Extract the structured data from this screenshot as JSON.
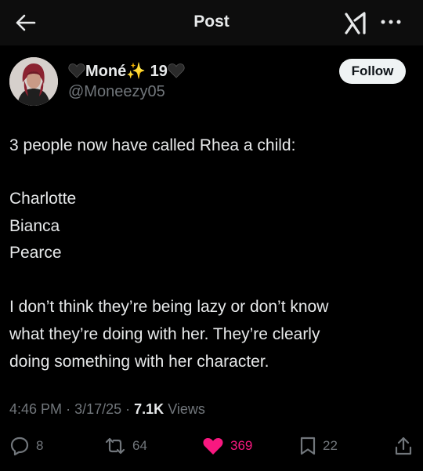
{
  "header": {
    "title": "Post",
    "back_icon": "arrow-left-icon",
    "grok_icon": "grok-icon",
    "more_icon": "more-dots-icon"
  },
  "author": {
    "display_name": "Moné✨ 19",
    "name_decorations": [
      "black-heart-emoji",
      "sparkles-emoji",
      "black-heart-emoji"
    ],
    "handle": "@Moneezy05",
    "follow_label": "Follow"
  },
  "post": {
    "lines": [
      "3 people now have called Rhea a child:",
      "",
      "Charlotte",
      "Bianca",
      "Pearce",
      "",
      "I don’t think they’re being lazy or don’t know",
      "what they’re doing with her. They’re clearly",
      "doing something with her character."
    ],
    "time": "4:46 PM",
    "date": "3/17/25",
    "views_count": "7.1K",
    "views_label": "Views"
  },
  "actions": {
    "replies": "8",
    "reposts": "64",
    "likes": "369",
    "bookmarks": "22"
  },
  "colors": {
    "background": "#000000",
    "header_background": "#0d0d0d",
    "text": "#e7e9ea",
    "secondary_text": "#71767b",
    "like_pink": "#f91880",
    "follow_button_bg": "#eff3f4"
  }
}
